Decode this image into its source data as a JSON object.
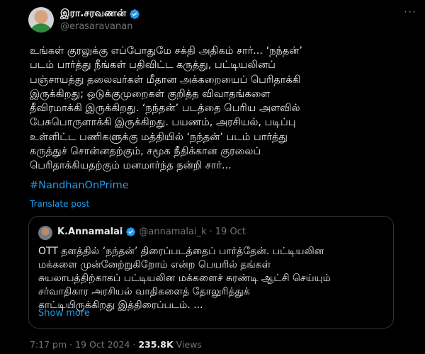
{
  "author": {
    "display_name": "இரா.சரவணன்",
    "handle": "@erasaravanan",
    "verified_color": "#1d9bf0"
  },
  "more_icon": "ellipsis-icon",
  "tweet": {
    "text": "உங்கள் குரலுக்கு எப்போதுமே சக்தி அதிகம் சார்... ‘நந்தன்’\nபடம் பார்த்து நீங்கள் பதிவிட்ட கருத்து, பட்டியலினப்\nபஞ்சாயத்து தலைவர்கள் மீதான அக்கறையைப் பெரிதாக்கி\nஇருக்கிறது; ஒடுக்குமுறைகள் குறித்த விவாதங்களை\nதீவிரமாக்கி இருக்கிறது. ‘நந்தன்’ படத்தை பெரிய அளவில்\nபேசுபொருளாக்கி இருக்கிறது. பயணம், அரசியல், படிப்பு\nஉள்ளிட்ட பணிகளுக்கு மத்தியில் ‘நந்தன்’ படம் பார்த்து\nகருத்துச் சொன்னதற்கும், சமூக நீதிக்கான குரலைப்\nபெரிதாக்கியதற்கும் மனமார்ந்த நன்றி சார்...",
    "hashtag": "#NandhanOnPrime",
    "translate_label": "Translate post"
  },
  "quote": {
    "display_name": "K.Annamalai",
    "handle": "@annamalai_k",
    "separator": "·",
    "date": "19 Oct",
    "text": "OTT தளத்தில் ‘நந்தன்’ திரைப்படத்தைப் பார்த்தேன். பட்டியலின\nமக்களை முன்னேற்றுகிறோம் என்ற பெயரில் தங்கள்\nசுயலாபத்திற்காகப் பட்டியலின மக்களைச் சுரண்டி ஆட்சி செய்யும்\nசர்வாதிகார அரசியல் வாதிகளைத் தோலுரித்துக்\nகாட்டியிருக்கிறது இத்திரைப்படம். ...",
    "show_more": "Show more"
  },
  "meta": {
    "time": "7:17 pm",
    "separator": "·",
    "date": "19 Oct 2024",
    "views_count": "235.8K",
    "views_label": "Views"
  }
}
